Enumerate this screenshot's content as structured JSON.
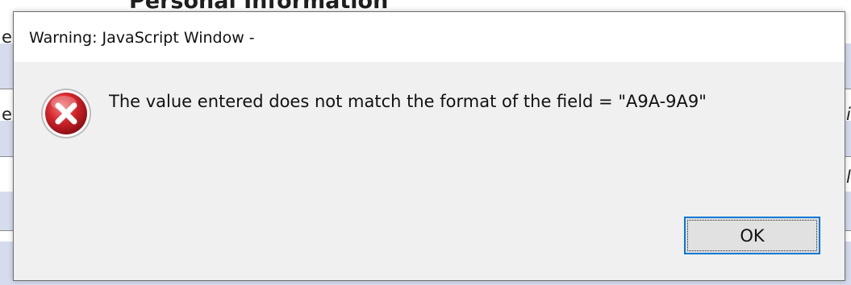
{
  "background": {
    "heading": "Personal Information",
    "left_fragments": [
      "e",
      "e"
    ],
    "right_fragments": [
      "i",
      "l"
    ],
    "band_color": "#d6dcee"
  },
  "dialog": {
    "title": "Warning: JavaScript Window -",
    "icon": "error-icon",
    "message": "The value entered does not match the format of the field = \"A9A-9A9\"",
    "ok_label": "OK",
    "accent_color": "#0078d7",
    "icon_color": "#d2232a"
  }
}
